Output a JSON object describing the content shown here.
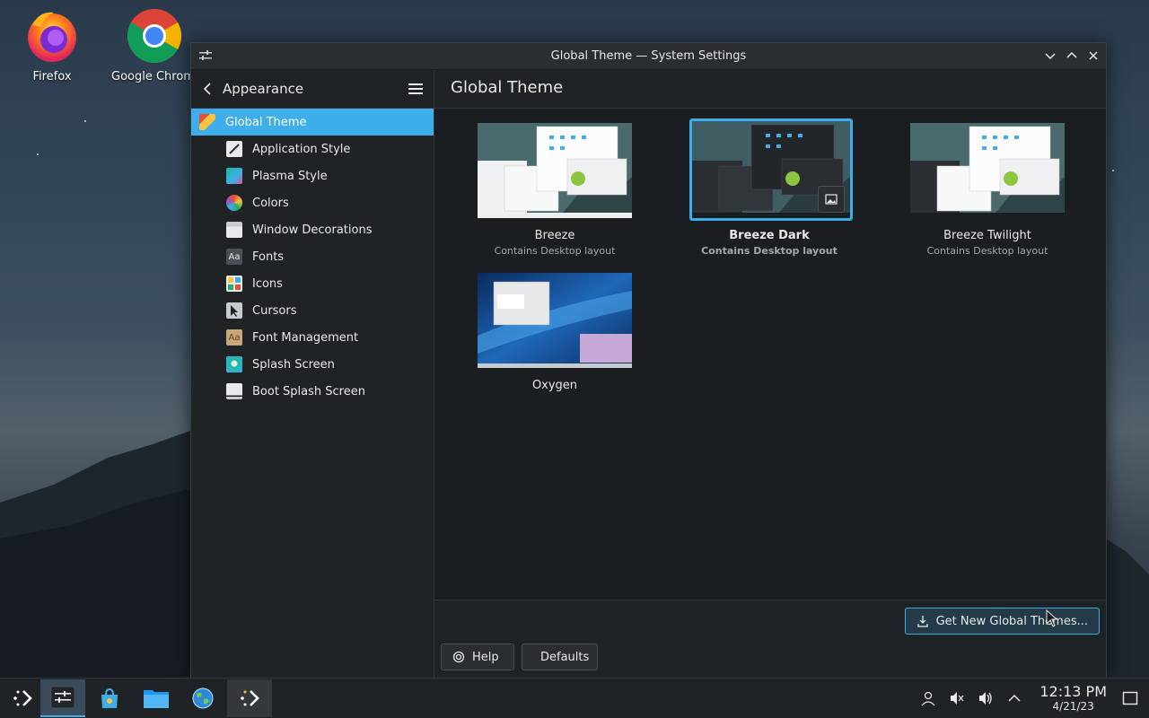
{
  "desktop": {
    "icons": [
      {
        "label": "Firefox",
        "icon": "firefox-icon"
      },
      {
        "label": "Google Chrome",
        "icon": "chrome-icon"
      }
    ]
  },
  "window": {
    "title": "Global Theme — System Settings",
    "sidebar": {
      "header": "Appearance",
      "items": [
        {
          "label": "Global Theme",
          "icon": "global-theme-icon",
          "selected": true
        },
        {
          "label": "Application Style",
          "icon": "application-style-icon"
        },
        {
          "label": "Plasma Style",
          "icon": "plasma-style-icon"
        },
        {
          "label": "Colors",
          "icon": "colors-icon"
        },
        {
          "label": "Window Decorations",
          "icon": "window-decorations-icon"
        },
        {
          "label": "Fonts",
          "icon": "fonts-icon",
          "glyph": "Aa"
        },
        {
          "label": "Icons",
          "icon": "icons-icon"
        },
        {
          "label": "Cursors",
          "icon": "cursors-icon"
        },
        {
          "label": "Font Management",
          "icon": "font-management-icon",
          "glyph": "Aa"
        },
        {
          "label": "Splash Screen",
          "icon": "splash-screen-icon"
        },
        {
          "label": "Boot Splash Screen",
          "icon": "boot-splash-screen-icon"
        }
      ]
    },
    "content": {
      "header": "Global Theme",
      "themes": [
        {
          "name": "Breeze",
          "subtitle": "Contains Desktop layout",
          "selected": false
        },
        {
          "name": "Breeze Dark",
          "subtitle": "Contains Desktop layout",
          "selected": true
        },
        {
          "name": "Breeze Twilight",
          "subtitle": "Contains Desktop layout",
          "selected": false
        },
        {
          "name": "Oxygen",
          "subtitle": "",
          "selected": false
        }
      ],
      "get_new_label": "Get New Global Themes...",
      "help_label": "Help",
      "defaults_label": "Defaults"
    }
  },
  "taskbar": {
    "items": [
      {
        "name": "app-launcher",
        "icon": "kde-launcher-icon"
      },
      {
        "name": "system-settings",
        "icon": "system-settings-icon",
        "active": true
      },
      {
        "name": "discover",
        "icon": "discover-store-icon"
      },
      {
        "name": "dolphin",
        "icon": "file-manager-icon"
      },
      {
        "name": "browser",
        "icon": "globe-icon"
      },
      {
        "name": "kde-connect",
        "icon": "kde-arrow-icon",
        "open": true
      }
    ],
    "clock": {
      "time": "12:13 PM",
      "date": "4/21/23"
    }
  },
  "colors": {
    "accent": "#3daee9",
    "window_bg": "#1b1e20",
    "panel_bg": "#202326"
  }
}
